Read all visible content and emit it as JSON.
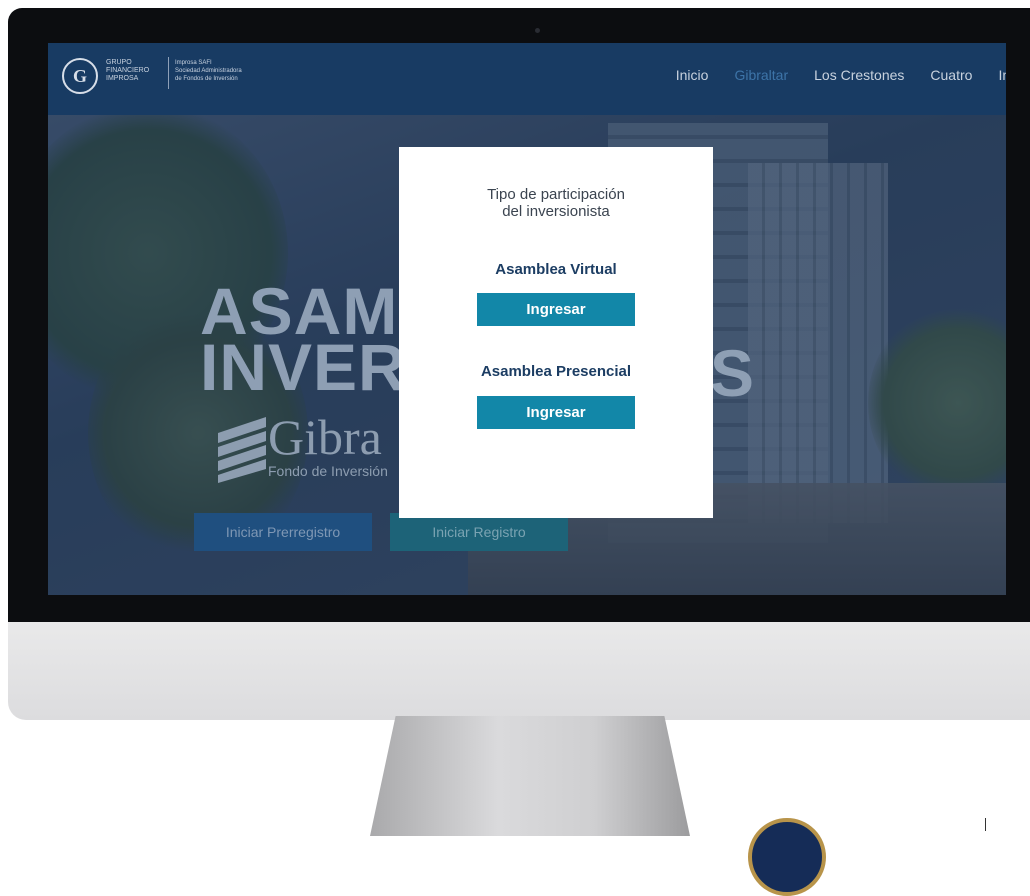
{
  "logo": {
    "group_lines": [
      "GRUPO",
      "FINANCIERO",
      "IMPROSA"
    ],
    "company_lines": [
      "Improsa SAFI",
      "Sociedad Administradora",
      "de Fondos de Inversión"
    ]
  },
  "nav": {
    "items": [
      "Inicio",
      "Gibraltar",
      "Los Crestones",
      "Cuatro",
      "Im"
    ],
    "active": "Gibraltar"
  },
  "hero": {
    "title_line1": "ASAMB",
    "title_line2": "INVERS",
    "title_tail": "S",
    "fund_name": "Gibra",
    "fund_subtitle": "Fondo de Inversión",
    "prereg_button": "Iniciar Prerregistro",
    "reg_button": "Iniciar Registro"
  },
  "modal": {
    "title_line1": "Tipo de participación",
    "title_line2": "del inversionista",
    "options": [
      {
        "label": "Asamblea Virtual",
        "button": "Ingresar"
      },
      {
        "label": "Asamblea Presencial",
        "button": "Ingresar"
      }
    ]
  },
  "colors": {
    "navbar": "#183b63",
    "button_accent": "#1287a8",
    "option_label": "#1c3d63"
  }
}
